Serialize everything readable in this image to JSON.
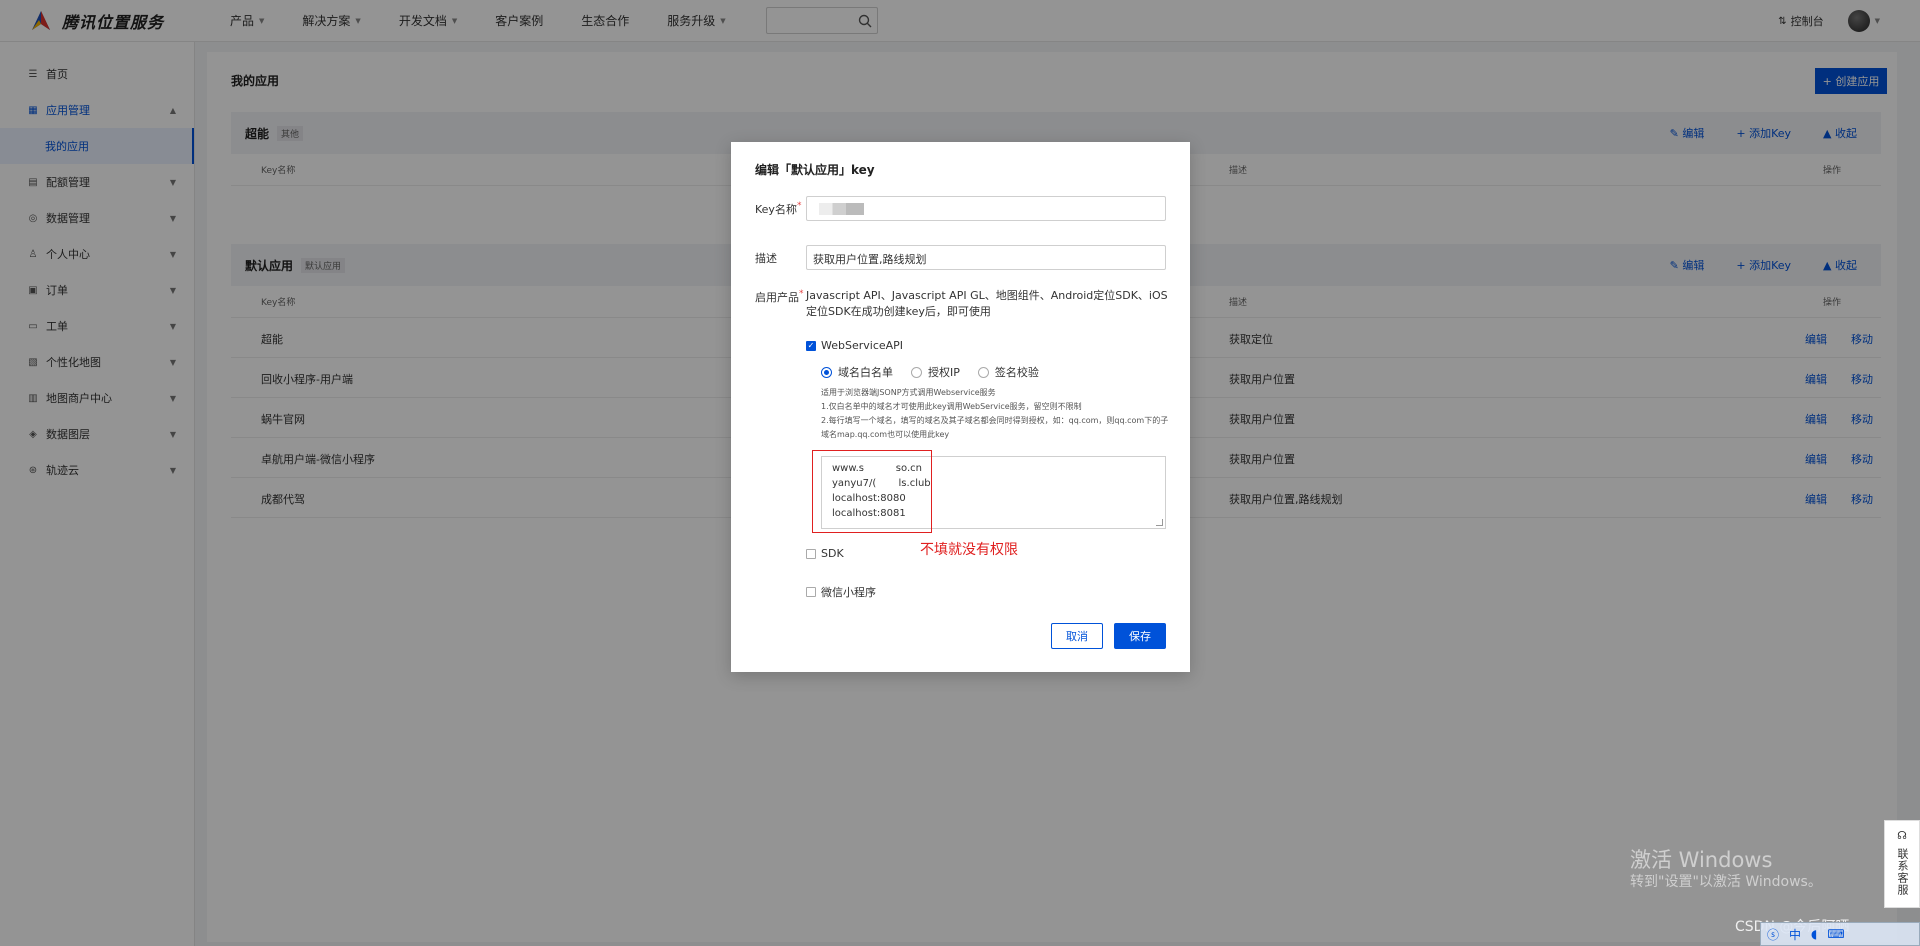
{
  "brand": {
    "name": "腾讯位置服务"
  },
  "nav": [
    {
      "label": "产品",
      "dropdown": true
    },
    {
      "label": "解决方案",
      "dropdown": true
    },
    {
      "label": "开发文档",
      "dropdown": true
    },
    {
      "label": "客户案例",
      "dropdown": false
    },
    {
      "label": "生态合作",
      "dropdown": false
    },
    {
      "label": "服务升级",
      "dropdown": true
    }
  ],
  "search": {
    "placeholder": ""
  },
  "header_right": {
    "console_label": "控制台"
  },
  "sidebar": {
    "items": [
      {
        "label": "首页",
        "icon": "list-icon"
      },
      {
        "label": "应用管理",
        "icon": "grid-icon",
        "active": true,
        "expanded": true
      },
      {
        "label": "配额管理",
        "icon": "quota-icon"
      },
      {
        "label": "数据管理",
        "icon": "database-icon"
      },
      {
        "label": "个人中心",
        "icon": "user-icon"
      },
      {
        "label": "订单",
        "icon": "order-icon"
      },
      {
        "label": "工单",
        "icon": "ticket-icon"
      },
      {
        "label": "个性化地图",
        "icon": "map-icon"
      },
      {
        "label": "地图商户中心",
        "icon": "store-icon"
      },
      {
        "label": "数据图层",
        "icon": "layers-icon"
      },
      {
        "label": "轨迹云",
        "icon": "track-icon"
      }
    ],
    "sub_item": "我的应用"
  },
  "main": {
    "title": "我的应用",
    "create_button": "+ 创建应用",
    "apps": [
      {
        "name": "超能",
        "tag": "其他",
        "actions": [
          "编辑",
          "+ 添加Key",
          "收起"
        ],
        "columns": {
          "key_name": "Key名称",
          "desc": "描述",
          "ops": "操作"
        },
        "rows": []
      },
      {
        "name": "默认应用",
        "tag": "默认应用",
        "actions": [
          "编辑",
          "+ 添加Key",
          "收起"
        ],
        "columns": {
          "key_name": "Key名称",
          "desc": "描述",
          "ops": "操作"
        },
        "rows": [
          {
            "name": "超能",
            "desc": "获取定位",
            "op1": "编辑",
            "op2": "移动"
          },
          {
            "name": "回收小程序-用户端",
            "desc": "获取用户位置",
            "op1": "编辑",
            "op2": "移动"
          },
          {
            "name": "蜗牛官网",
            "desc": "获取用户位置",
            "op1": "编辑",
            "op2": "移动"
          },
          {
            "name": "卓航用户端-微信小程序",
            "desc": "获取用户位置",
            "op1": "编辑",
            "op2": "移动"
          },
          {
            "name": "成都代驾",
            "desc": "获取用户位置,路线规划",
            "op1": "编辑",
            "op2": "移动"
          }
        ]
      }
    ]
  },
  "modal": {
    "title": "编辑「默认应用」key",
    "key_name_label": "Key名称",
    "desc_label": "描述",
    "desc_value": "获取用户位置,路线规划",
    "products_label": "启用产品",
    "products_text": "Javascript API、Javascript API GL、地图组件、Android定位SDK、iOS定位SDK在成功创建key后，即可使用",
    "webservice_label": "WebServiceAPI",
    "radio_options": [
      "域名白名单",
      "授权IP",
      "签名校验"
    ],
    "note_lines": [
      "适用于浏览器端JSONP方式调用Webservice服务",
      "1.仅白名单中的域名才可使用此key调用WebService服务，留空则不限制",
      "2.每行填写一个域名，填写的域名及其子域名都会同时得到授权，如：qq.com，则qq.com下的子域名map.qq.com也可以使用此key"
    ],
    "whitelist_lines": [
      "www.s          so.cn",
      "yanyu7/(       ls.club",
      "localhost:8080",
      "localhost:8081"
    ],
    "annotation": "不填就没有权限",
    "sdk_label": "SDK",
    "miniprogram_label": "微信小程序",
    "cancel_label": "取消",
    "save_label": "保存"
  },
  "watermark": {
    "line1": "激活 Windows",
    "line2": "转到\"设置\"以激活 Windows。"
  },
  "contact": {
    "label": "联系客服"
  },
  "csdn": "CSDN @今后阿晒"
}
